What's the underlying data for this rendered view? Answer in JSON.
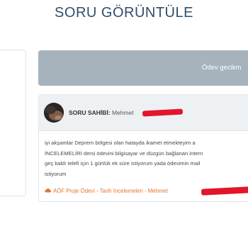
{
  "page": {
    "title": "SORU GÖRÜNTÜLE"
  },
  "alert": {
    "text": "Ödev gecikm"
  },
  "question": {
    "asker_label": "SORU SAHİBİ:",
    "asker_name": "Mehmet",
    "body_lines": [
      "iyi akşamlar Deprem bölgesi olan hatayda ikamet etmekteyim  a",
      "İNCELEMELİRİ dersi ödevini bilgisayar ve düzgün bağlanan intern",
      "geç kaldı telefi için 1 günlük ek süre istiyorum yada ödevimin mail",
      "istiyorum"
    ],
    "tags": "AÖF Proje Ödevi - Tarih İncelemeleri - Mehmet"
  },
  "colors": {
    "title": "#2f4e6b",
    "alert_bg": "#a6b3bd",
    "card_header_bg": "#edf1f4",
    "tag_accent": "#e07733",
    "redaction": "#e3152b"
  },
  "icons": {
    "tag_icon": "cloud-icon"
  }
}
